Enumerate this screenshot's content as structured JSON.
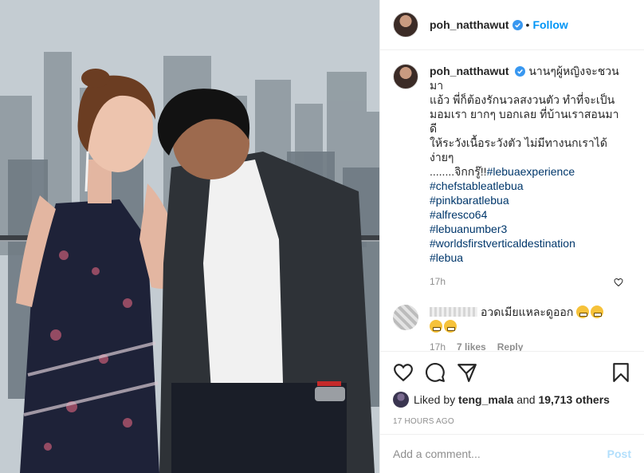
{
  "header": {
    "username": "poh_natthawut",
    "dot": "•",
    "follow_label": "Follow"
  },
  "caption": {
    "username": "poh_natthawut",
    "lines": [
      "นานๆผู้หญิงจะชวนมา",
      "แอ้ว พี่ก็ต้องรักนวลสงวนตัว ทำที่จะเป็น",
      "มอมเรา ยากๆ บอกเลย ที่บ้านเราสอนมาดี",
      "ให้ระวังเนื้อระวังตัว ไม่มีทางนกเราได้ง่ายๆ",
      "........จิกกรู๊!!"
    ],
    "inline_tag": "#lebuaexperience",
    "hashtags": [
      "#chefstableatlebua",
      "#pinkbaratlebua",
      "#alfresco64",
      "#lebuanumber3",
      "#worldsfirstverticaldestination",
      "#lebua"
    ],
    "time": "17h"
  },
  "comment": {
    "text": "อวดเมียแหละดูออก",
    "time": "17h",
    "likes": "7 likes",
    "reply_label": "Reply"
  },
  "likes": {
    "prefix": "Liked by",
    "user": "teng_mala",
    "and": "and",
    "count": "19,713 others"
  },
  "posted_ago": "17 HOURS AGO",
  "add_comment": {
    "placeholder": "Add a comment...",
    "post_label": "Post"
  },
  "colors": {
    "link_blue": "#0095f6",
    "hashtag": "#00376b",
    "muted": "#8e8e8e",
    "post_disabled": "#b2dffc"
  },
  "icons": [
    "verified-badge-icon",
    "heart-icon",
    "comment-icon",
    "share-icon",
    "bookmark-icon",
    "small-heart-icon"
  ]
}
